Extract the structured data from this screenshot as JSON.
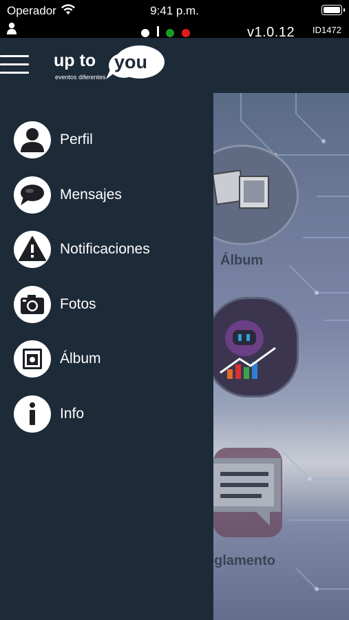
{
  "status_bar": {
    "carrier": "Operador",
    "time": "9:41 p.m.",
    "version": "v1.0.12",
    "device_id": "ID1472"
  },
  "header": {
    "logo_text_left": "up to",
    "logo_text_right": "you",
    "logo_tagline": "eventos diferentes"
  },
  "drawer": {
    "items": [
      {
        "label": "Perfil",
        "icon": "person-icon"
      },
      {
        "label": "Mensajes",
        "icon": "chat-bubble-icon"
      },
      {
        "label": "Notificaciones",
        "icon": "warning-icon"
      },
      {
        "label": "Fotos",
        "icon": "camera-icon"
      },
      {
        "label": "Álbum",
        "icon": "album-icon"
      },
      {
        "label": "Info",
        "icon": "info-icon"
      }
    ]
  },
  "main": {
    "tile_album_label": "Álbum",
    "tile_reglamento_label": "eglamento"
  },
  "colors": {
    "drawer_bg": "#1d2a38",
    "status_green": "#1a9b22",
    "status_red": "#e31b1b"
  }
}
